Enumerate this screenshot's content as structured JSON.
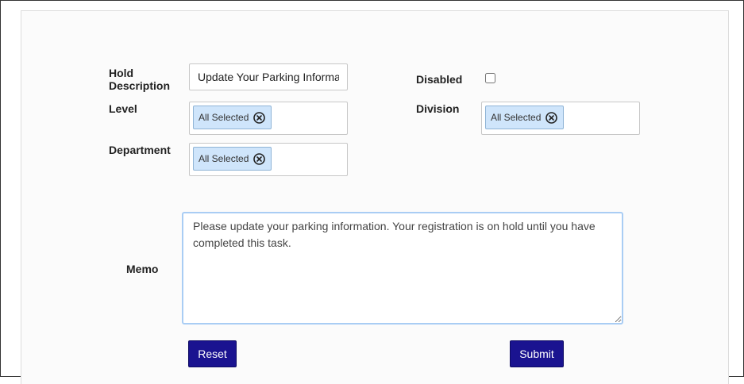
{
  "form": {
    "hold_description": {
      "label": "Hold Description",
      "value": "Update Your Parking Information"
    },
    "disabled": {
      "label": "Disabled",
      "checked": false
    },
    "level": {
      "label": "Level",
      "chip": "All Selected"
    },
    "division": {
      "label": "Division",
      "chip": "All Selected"
    },
    "department": {
      "label": "Department",
      "chip": "All Selected"
    },
    "memo": {
      "label": "Memo",
      "value": "Please update your parking information. Your registration is on hold until you have completed this task."
    }
  },
  "actions": {
    "reset_label": "Reset",
    "submit_label": "Submit"
  },
  "colors": {
    "primary_button": "#1a1390",
    "chip_background": "#cfe5fb",
    "memo_focus_border": "#a9cdf4"
  }
}
